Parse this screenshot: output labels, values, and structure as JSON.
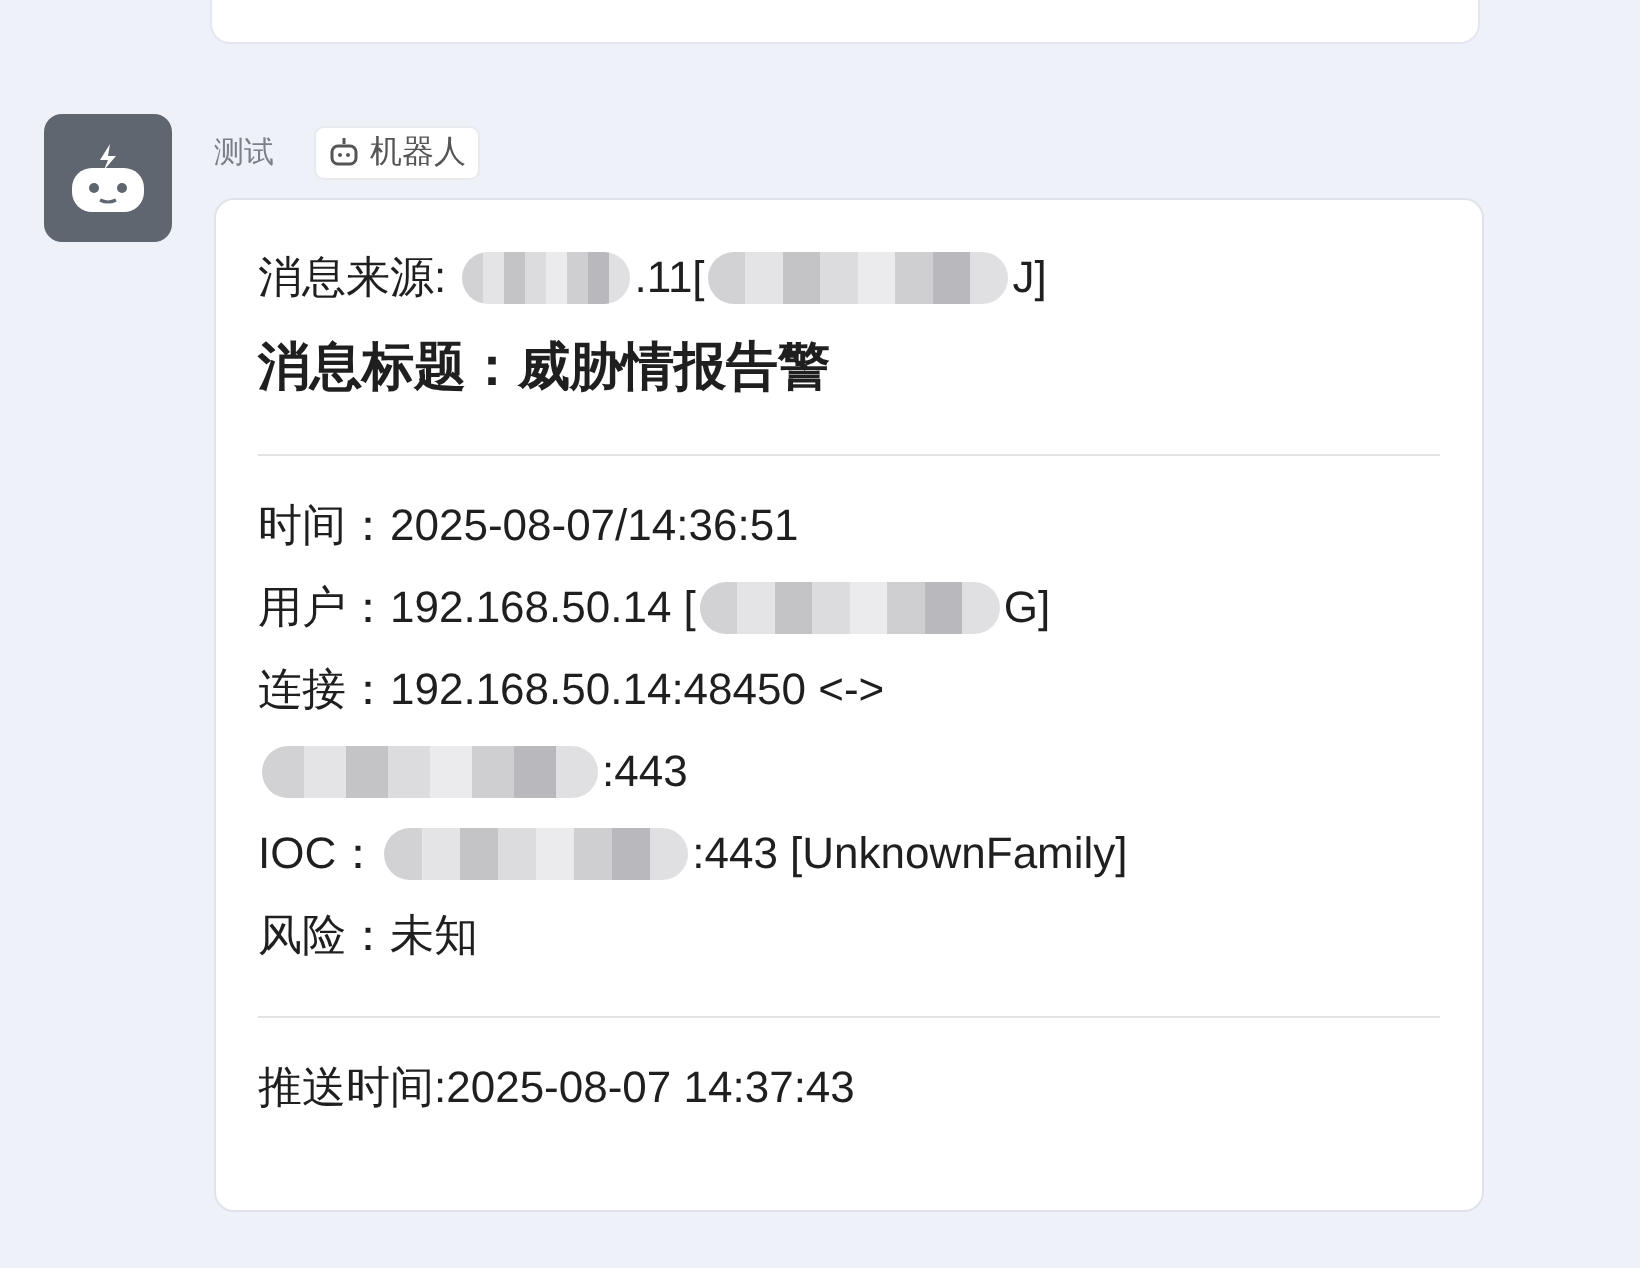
{
  "previous_message": {
    "kind": "card"
  },
  "message": {
    "sender": "测试",
    "tag": {
      "label": "机器人"
    },
    "source": [
      {
        "kind": "text",
        "text": "消息来源: "
      },
      {
        "kind": "redacted"
      },
      {
        "kind": "text",
        "text": ".11["
      },
      {
        "kind": "redacted"
      },
      {
        "kind": "text",
        "text": "J]"
      }
    ],
    "title": "消息标题：威胁情报告警",
    "lines": [
      [
        {
          "kind": "text",
          "text": "时间：2025-08-07/14:36:51"
        }
      ],
      [
        {
          "kind": "text",
          "text": "用户：192.168.50.14 ["
        },
        {
          "kind": "redacted"
        },
        {
          "kind": "text",
          "text": "G]"
        }
      ],
      [
        {
          "kind": "text",
          "text": "连接：192.168.50.14:48450 <->"
        }
      ],
      [
        {
          "kind": "redacted"
        },
        {
          "kind": "text",
          "text": ":443"
        }
      ],
      [
        {
          "kind": "text",
          "text": "IOC："
        },
        {
          "kind": "redacted"
        },
        {
          "kind": "text",
          "text": ":443 [UnknownFamily]"
        }
      ],
      [
        {
          "kind": "text",
          "text": "风险：未知"
        }
      ]
    ],
    "footer": "推送时间:2025-08-07 14:37:43"
  }
}
